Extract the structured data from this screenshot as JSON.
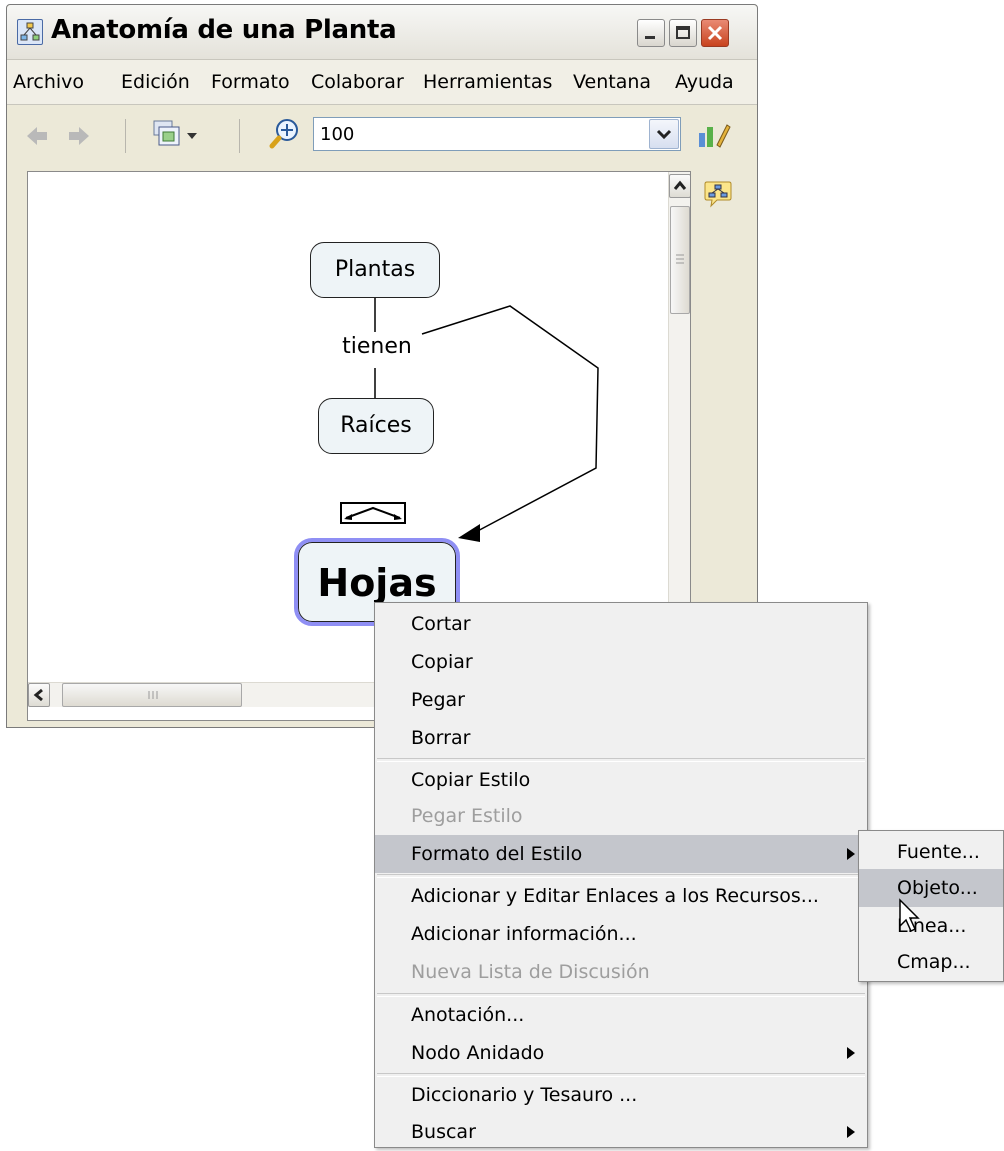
{
  "window": {
    "title": "Anatomía de una Planta",
    "controls": {
      "minimize": "minimize-icon",
      "maximize": "maximize-icon",
      "close": "close-icon"
    }
  },
  "menubar": [
    "Archivo",
    "Edición",
    "Formato",
    "Colaborar",
    "Herramientas",
    "Ventana",
    "Ayuda"
  ],
  "toolbar": {
    "zoom_value": "100",
    "icons": [
      "back-arrow-icon",
      "forward-arrow-icon",
      "views-icon",
      "zoom-icon",
      "styles-icon"
    ]
  },
  "cmap": {
    "nodes": {
      "plantas": "Plantas",
      "raices": "Raíces",
      "hojas": "Hojas"
    },
    "link_label": "tienen"
  },
  "context_menu": {
    "items": [
      {
        "label": "Cortar"
      },
      {
        "label": "Copiar"
      },
      {
        "label": "Pegar"
      },
      {
        "label": "Borrar"
      },
      {
        "label": "Copiar Estilo"
      },
      {
        "label": "Pegar Estilo",
        "disabled": true
      },
      {
        "label": "Formato del Estilo",
        "submenu": true,
        "highlighted": true
      },
      {
        "label": "Adicionar y Editar Enlaces a los Recursos..."
      },
      {
        "label": "Adicionar información..."
      },
      {
        "label": "Nueva Lista de Discusión",
        "disabled": true
      },
      {
        "label": "Anotación..."
      },
      {
        "label": "Nodo Anidado",
        "submenu": true
      },
      {
        "label": "Diccionario y Tesauro ..."
      },
      {
        "label": "Buscar",
        "submenu": true
      }
    ]
  },
  "submenu": {
    "items": [
      {
        "label": "Fuente..."
      },
      {
        "label": "Objeto...",
        "highlighted": true
      },
      {
        "label": "Línea..."
      },
      {
        "label": "Cmap..."
      }
    ]
  },
  "colors": {
    "selection_highlight": "#c4c6cc",
    "selected_node_border": "#8f8ff4",
    "disabled_text": "#9e9e9e"
  }
}
